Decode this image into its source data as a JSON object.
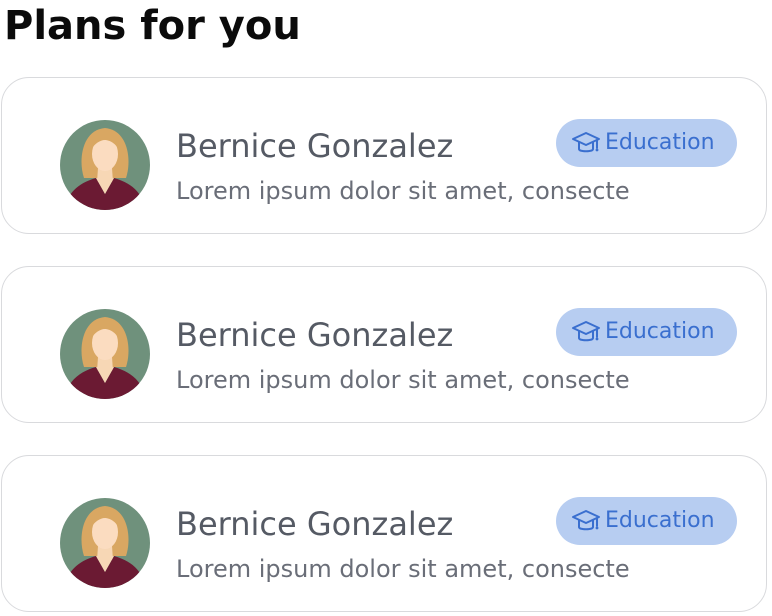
{
  "header": {
    "title": "Plans for you"
  },
  "plans": [
    {
      "name": "Bernice Gonzalez",
      "description": "Lorem ipsum dolor sit amet, consecte",
      "category": "Education",
      "category_icon": "graduation-cap-icon"
    },
    {
      "name": "Bernice Gonzalez",
      "description": "Lorem ipsum dolor sit amet, consecte",
      "category": "Education",
      "category_icon": "graduation-cap-icon"
    },
    {
      "name": "Bernice Gonzalez",
      "description": "Lorem ipsum dolor sit amet, consecte",
      "category": "Education",
      "category_icon": "graduation-cap-icon"
    }
  ],
  "colors": {
    "card_border": "#d9dadd",
    "badge_background": "#b7cdf1",
    "badge_text": "#3a6fcf",
    "name_text": "#555a64",
    "avatar_background": "#6f917c",
    "avatar_shirt": "#6b1a33"
  }
}
